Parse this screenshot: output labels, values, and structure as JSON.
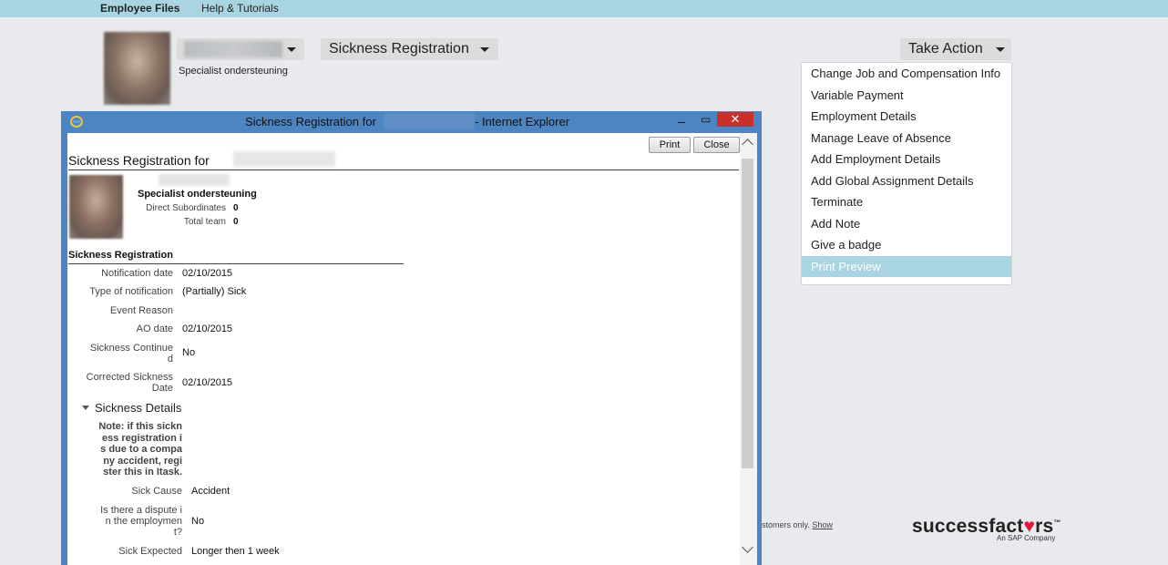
{
  "topnav": {
    "employee_files": "Employee Files",
    "help": "Help & Tutorials"
  },
  "profile": {
    "job_title": "Specialist ondersteuning",
    "view_selector": "Sickness Registration",
    "take_action": "Take Action"
  },
  "action_menu": [
    "Change Job and Compensation Info",
    "Variable Payment",
    "Employment Details",
    "Manage Leave of Absence",
    "Add Employment Details",
    "Add Global Assignment Details",
    "Terminate",
    "Add Note",
    "Give a badge",
    "Print Preview"
  ],
  "footer": {
    "text": "stomers only.",
    "show_link": "Show",
    "logo_a": "successfact",
    "logo_heart": "♥",
    "logo_b": "rs",
    "tm": "™",
    "logo_sub": "An SAP Company"
  },
  "ie_window": {
    "title_prefix": "Sickness Registration for",
    "title_suffix": "- Internet Explorer",
    "min": "–",
    "max": "▭",
    "close": "✕"
  },
  "popup": {
    "print_btn": "Print",
    "close_btn": "Close",
    "page_title": "Sickness Registration for",
    "job_title": "Specialist ondersteuning",
    "direct_subs_label": "Direct Subordinates",
    "direct_subs_value": "0",
    "total_team_label": "Total team",
    "total_team_value": "0",
    "section_title": "Sickness Registration",
    "fields": [
      {
        "label": "Notification date",
        "value": "02/10/2015"
      },
      {
        "label": "Type of notification",
        "value": "(Partially) Sick"
      },
      {
        "label": "Event Reason",
        "value": ""
      },
      {
        "label": "AO date",
        "value": "02/10/2015"
      },
      {
        "label_l1": "Sickness Continue",
        "label_l2": "d",
        "value": "No"
      },
      {
        "label_l1": "Corrected Sickness",
        "label_l2": "Date",
        "value": "02/10/2015"
      }
    ],
    "details_title": "Sickness Details",
    "note_lines": [
      "Note: if this sickn",
      "ess registration i",
      "s due to a compa",
      "ny accident, regi",
      "ster this in Itask."
    ],
    "sick_cause_label": "Sick Cause",
    "sick_cause_value": "Accident",
    "dispute_lines": [
      "Is there a dispute i",
      "n the employmen",
      "t?"
    ],
    "dispute_value": "No",
    "sick_expected_label": "Sick Expected",
    "sick_expected_value": "Longer then 1 week"
  }
}
